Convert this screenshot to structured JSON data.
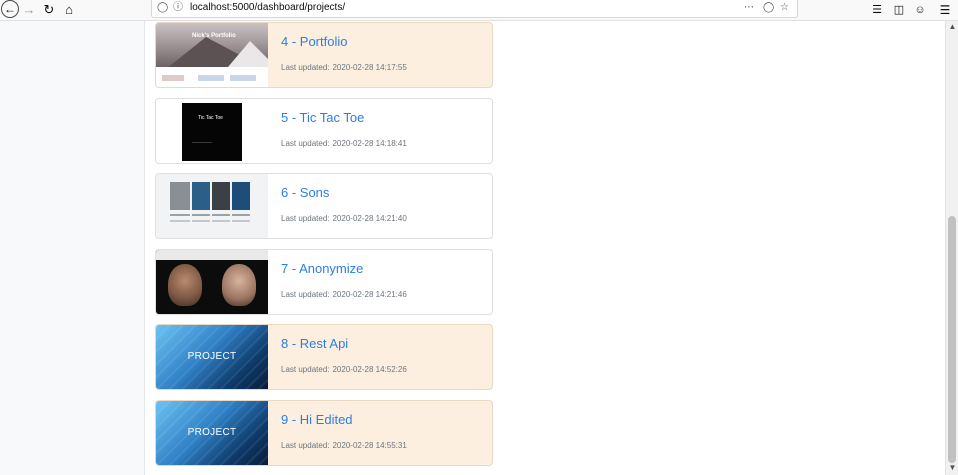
{
  "browser": {
    "url": "localhost:5000/dashboard/projects/"
  },
  "projects": [
    {
      "title": "4 - Portfolio",
      "meta_label": "Last updated:",
      "updated": "2020-02-28 14:17:55",
      "thumb_label": "Nick's Portfolio"
    },
    {
      "title": "5 - Tic Tac Toe",
      "meta_label": "Last updated:",
      "updated": "2020-02-28 14:18:41",
      "thumb_label": "Tic Tac Toe"
    },
    {
      "title": "6 - Sons",
      "meta_label": "Last updated:",
      "updated": "2020-02-28 14:21:40"
    },
    {
      "title": "7 - Anonymize",
      "meta_label": "Last updated:",
      "updated": "2020-02-28 14:21:46"
    },
    {
      "title": "8 - Rest Api",
      "meta_label": "Last updated:",
      "updated": "2020-02-28 14:52:26",
      "thumb_label": "PROJECT"
    },
    {
      "title": "9 - Hi Edited",
      "meta_label": "Last updated:",
      "updated": "2020-02-28 14:55:31",
      "thumb_label": "PROJECT"
    }
  ],
  "colors": {
    "card_warm_bg": "#fcefe0",
    "link": "#2a7ee6",
    "meta": "#6c757d"
  }
}
